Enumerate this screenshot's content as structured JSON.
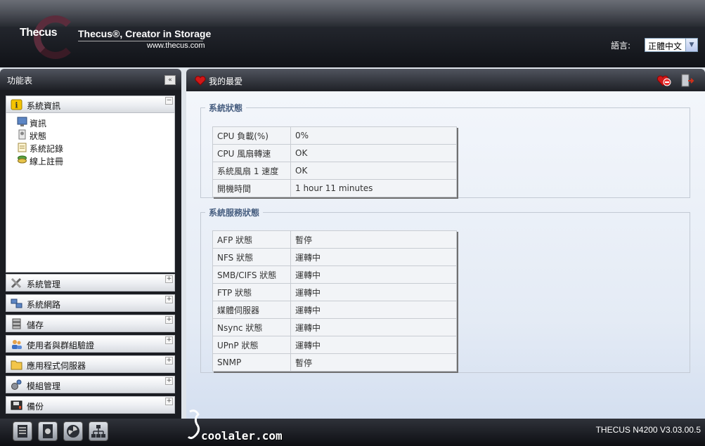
{
  "header": {
    "logo": "Thecus",
    "tagline": "Thecus®, Creator in Storage",
    "website": "www.thecus.com",
    "language_label": "語言:",
    "language_value": "正體中文"
  },
  "sidebar": {
    "title": "功能表",
    "active_section": {
      "label": "系統資訊",
      "items": [
        {
          "label": "資訊",
          "icon": "monitor-icon"
        },
        {
          "label": "狀態",
          "icon": "status-icon"
        },
        {
          "label": "系統記錄",
          "icon": "log-icon"
        },
        {
          "label": "線上註冊",
          "icon": "register-icon"
        }
      ]
    },
    "sections": [
      {
        "label": "系統管理",
        "icon": "tools-icon"
      },
      {
        "label": "系統網路",
        "icon": "network-icon"
      },
      {
        "label": "儲存",
        "icon": "storage-icon"
      },
      {
        "label": "使用者與群組驗證",
        "icon": "users-icon"
      },
      {
        "label": "應用程式伺服器",
        "icon": "folder-icon"
      },
      {
        "label": "模組管理",
        "icon": "module-icon"
      },
      {
        "label": "備份",
        "icon": "backup-icon"
      }
    ]
  },
  "main": {
    "favorites_title": "我的最愛",
    "system_status": {
      "title": "系統狀態",
      "rows": [
        {
          "key": "CPU 負載(%)",
          "value": "0%"
        },
        {
          "key": "CPU 風扇轉速",
          "value": "OK"
        },
        {
          "key": "系統風扇 1 速度",
          "value": "OK"
        },
        {
          "key": "開機時間",
          "value": "1 hour 11 minutes"
        }
      ]
    },
    "service_status": {
      "title": "系統服務狀態",
      "rows": [
        {
          "key": "AFP 狀態",
          "value": "暫停",
          "state": "stopped"
        },
        {
          "key": "NFS 狀態",
          "value": "運轉中",
          "state": "running"
        },
        {
          "key": "SMB/CIFS 狀態",
          "value": "運轉中",
          "state": "running"
        },
        {
          "key": "FTP 狀態",
          "value": "運轉中",
          "state": "running"
        },
        {
          "key": "媒體伺服器",
          "value": "運轉中",
          "state": "running"
        },
        {
          "key": "Nsync 狀態",
          "value": "運轉中",
          "state": "running"
        },
        {
          "key": "UPnP 狀態",
          "value": "運轉中",
          "state": "running"
        },
        {
          "key": "SNMP",
          "value": "暫停",
          "state": "stopped"
        }
      ]
    }
  },
  "footer": {
    "version": "THECUS N4200 V3.03.00.5",
    "watermark": "coolaler.com",
    "buttons": [
      "server-icon",
      "disk-icon",
      "fan-icon",
      "network-tree-icon"
    ]
  },
  "colors": {
    "stopped": "#d10000",
    "running": "#1a1aa8",
    "legend": "#475e80"
  }
}
